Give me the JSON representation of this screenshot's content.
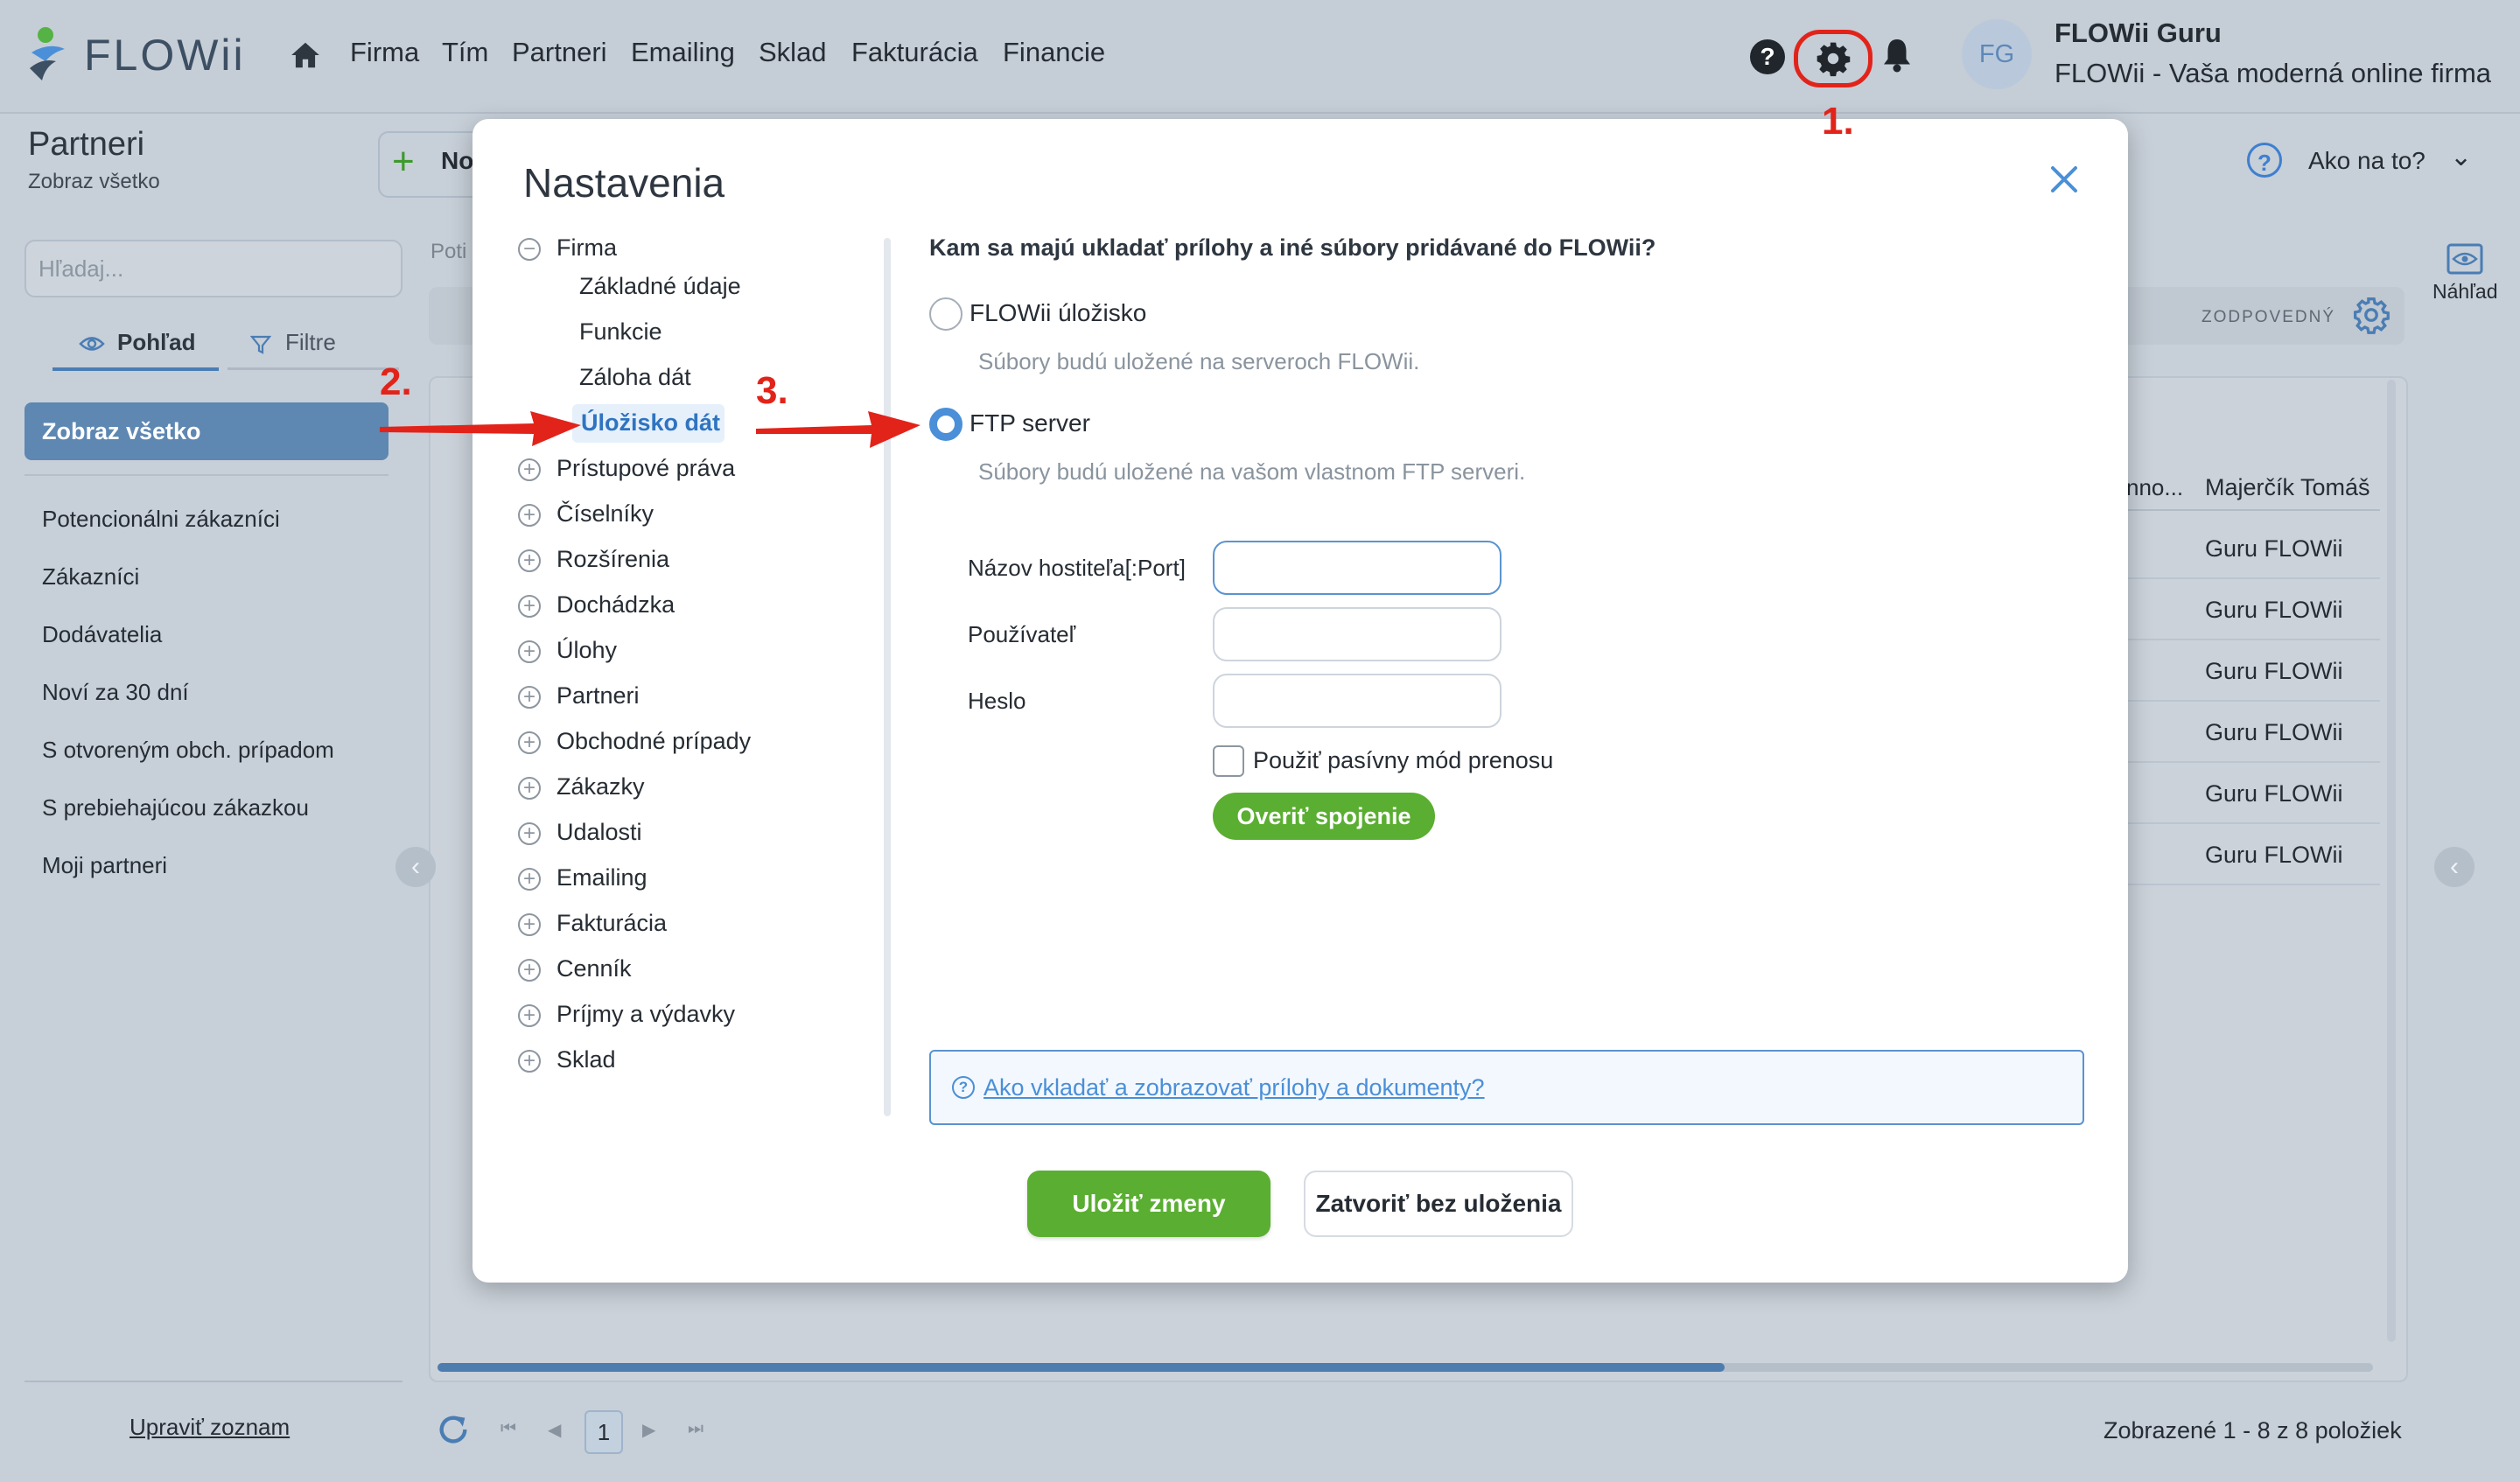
{
  "app": {
    "logo_text": "FLOWii",
    "nav": [
      "Firma",
      "Tím",
      "Partneri",
      "Emailing",
      "Sklad",
      "Fakturácia",
      "Financie"
    ],
    "user": {
      "initials": "FG",
      "name": "FLOWii Guru",
      "company": "FLOWii - Vaša moderná online firma"
    },
    "icons": {
      "home": "home-icon",
      "help": "help-icon",
      "settings": "gear-icon",
      "notifications": "bell-icon"
    }
  },
  "annotations": {
    "step1": "1.",
    "step2": "2.",
    "step3": "3.",
    "color": "#e2231a"
  },
  "page": {
    "title": "Partneri",
    "subtitle": "Zobraz všetko",
    "new_button": "No",
    "help_label": "Ako na to?",
    "search_placeholder": "Hľadaj...",
    "tabs": {
      "view": "Pohľad",
      "filter": "Filtre"
    },
    "sidebar_active": "Zobraz všetko",
    "sidebar_items": [
      "Potencionálni zákazníci",
      "Zákazníci",
      "Dodávatelia",
      "Noví za 30 dní",
      "S otvoreným obch. prípadom",
      "S prebiehajúcou zákazkou",
      "Moji partneri"
    ],
    "edit_list": "Upraviť zoznam",
    "partial_label": "Poti",
    "responsible_label": "ZODPOVEDNÝ",
    "preview_label": "Náhľad",
    "columns": [
      "nno...",
      "Majerčík Tomáš"
    ],
    "rows": [
      "Guru FLOWii",
      "Guru FLOWii",
      "Guru FLOWii",
      "Guru FLOWii",
      "Guru FLOWii",
      "Guru FLOWii"
    ],
    "pager": {
      "page": "1",
      "info": "Zobrazené 1 - 8 z 8 položiek"
    },
    "horizontal_scroll_fraction": 0.665
  },
  "modal": {
    "title": "Nastavenia",
    "tree": {
      "root": "Firma",
      "children": [
        "Základné údaje",
        "Funkcie",
        "Záloha dát"
      ],
      "active_child": "Úložisko dát",
      "collapsed": [
        "Prístupové práva",
        "Číselníky",
        "Rozšírenia",
        "Dochádzka",
        "Úlohy",
        "Partneri",
        "Obchodné prípady",
        "Zákazky",
        "Udalosti",
        "Emailing",
        "Fakturácia",
        "Cenník",
        "Príjmy a výdavky",
        "Sklad"
      ]
    },
    "question": "Kam sa majú ukladať prílohy a iné súbory pridávané do FLOWii?",
    "options": [
      {
        "label": "FLOWii úložisko",
        "description": "Súbory budú uložené na serveroch FLOWii.",
        "selected": false
      },
      {
        "label": "FTP server",
        "description": "Súbory budú uložené na vašom vlastnom FTP serveri.",
        "selected": true
      }
    ],
    "fields": {
      "host_label": "Názov hostiteľa[:Port]",
      "host_value": "",
      "user_label": "Používateľ",
      "user_value": "",
      "password_label": "Heslo",
      "password_value": ""
    },
    "passive_mode_label": "Použiť pasívny mód prenosu",
    "passive_mode_checked": false,
    "verify_button": "Overiť spojenie",
    "help_link": "Ako vkladať a zobrazovať prílohy a dokumenty?",
    "save_button": "Uložiť zmeny",
    "close_button": "Zatvoriť bez uloženia",
    "colors": {
      "primary": "#4a8fd8",
      "success": "#5aae31"
    }
  }
}
